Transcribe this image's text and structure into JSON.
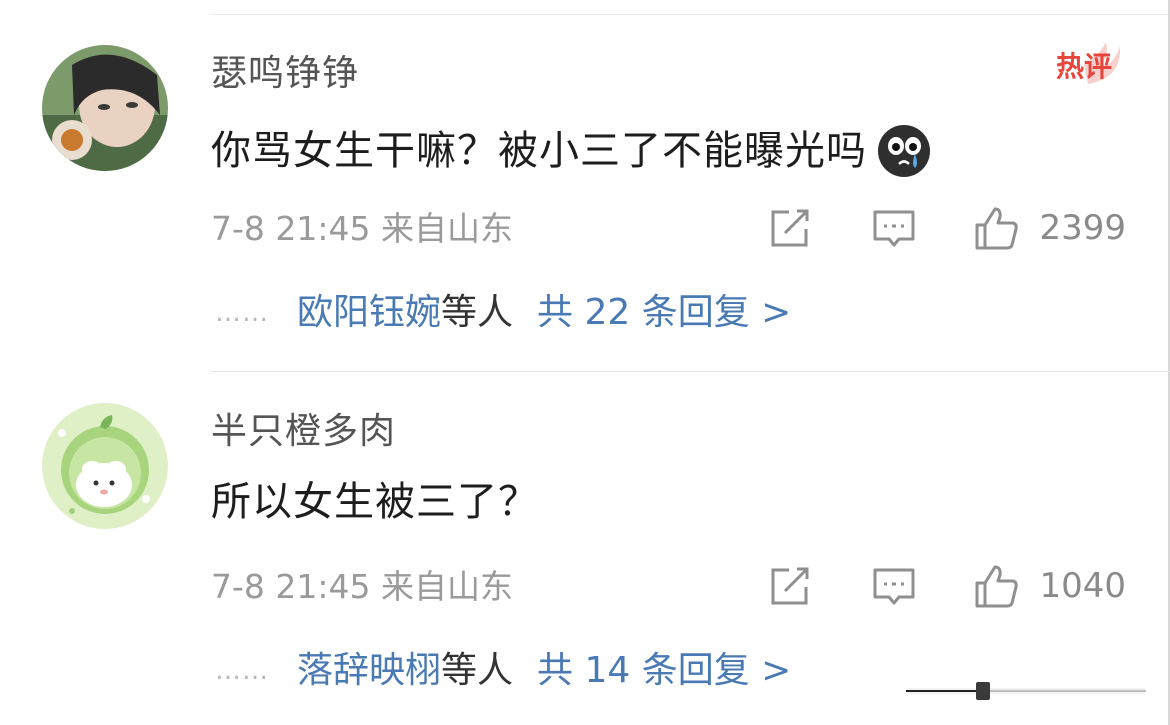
{
  "comments": [
    {
      "username": "瑟鸣铮铮",
      "text": "你骂女生干嘛？被小三了不能曝光吗",
      "emoji": "crying-face",
      "timestamp": "7-8 21:45",
      "location": "来自山东",
      "likes": "2399",
      "badge": "热评",
      "reply_names": "欧阳钰婉",
      "reply_suffix": "等人",
      "reply_count": "共 22 条回复 >"
    },
    {
      "username": "半只橙多肉",
      "text": "所以女生被三了？",
      "timestamp": "7-8 21:45",
      "location": "来自山东",
      "likes": "1040",
      "reply_names": "落辞映栩",
      "reply_suffix": "等人",
      "reply_count": "共 14 条回复 >"
    }
  ],
  "reply_dots": "……",
  "icons": [
    "share-icon",
    "reply-icon",
    "thumbs-up-icon",
    "hot-comment-badge",
    "crying-face-emoji"
  ],
  "colors": {
    "link": "#4a7ab3",
    "meta": "#9a9a9a",
    "badge": "#e8453c"
  }
}
